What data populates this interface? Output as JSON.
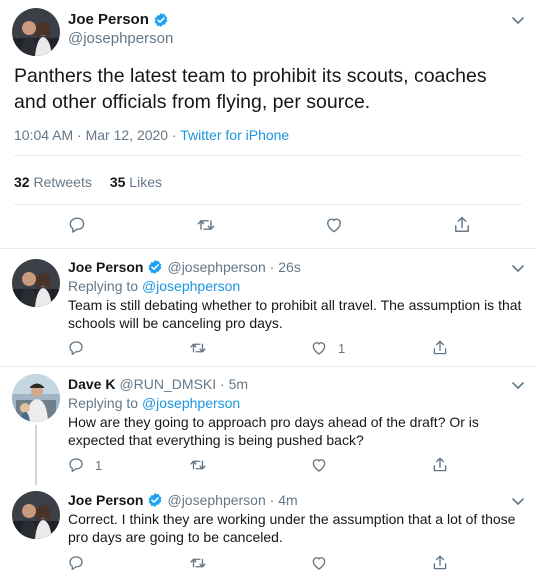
{
  "main_tweet": {
    "name": "Joe Person",
    "handle": "@josephperson",
    "text": "Panthers the latest team to prohibit its scouts, coaches and other officials from flying, per source.",
    "timestamp": "10:04 AM · Mar 12, 2020 · ",
    "source": "Twitter for iPhone",
    "retweets_count": "32",
    "retweets_label": "Retweets",
    "likes_count": "35",
    "likes_label": "Likes"
  },
  "replies": [
    {
      "name": "Joe Person",
      "handle": "@josephperson · 26s",
      "replying_prefix": "Replying to ",
      "replying_to": "@josephperson",
      "text": "Team is still debating whether to prohibit all travel. The assumption is that schools will be canceling pro days.",
      "reply_count": "",
      "retweet_count": "",
      "like_count": "1"
    },
    {
      "name": "Dave K",
      "handle": "@RUN_DMSKI · 5m",
      "replying_prefix": "Replying to ",
      "replying_to": "@josephperson",
      "text": "How are they going to approach pro days ahead of the draft? Or is expected that everything is being pushed back?",
      "reply_count": "1",
      "retweet_count": "",
      "like_count": ""
    },
    {
      "name": "Joe Person",
      "handle": "@josephperson · 4m",
      "text": "Correct. I think they are working under the assumption that a lot of those pro days are going to be canceled.",
      "reply_count": "",
      "retweet_count": "",
      "like_count": ""
    }
  ],
  "colors": {
    "link": "#1b95e0",
    "secondary_text": "#657786",
    "divider": "#e6ecf0",
    "verified": "#1da1f2"
  },
  "icons": [
    "chevron-down-icon",
    "verified-badge-icon",
    "reply-icon",
    "retweet-icon",
    "like-icon",
    "share-icon"
  ]
}
